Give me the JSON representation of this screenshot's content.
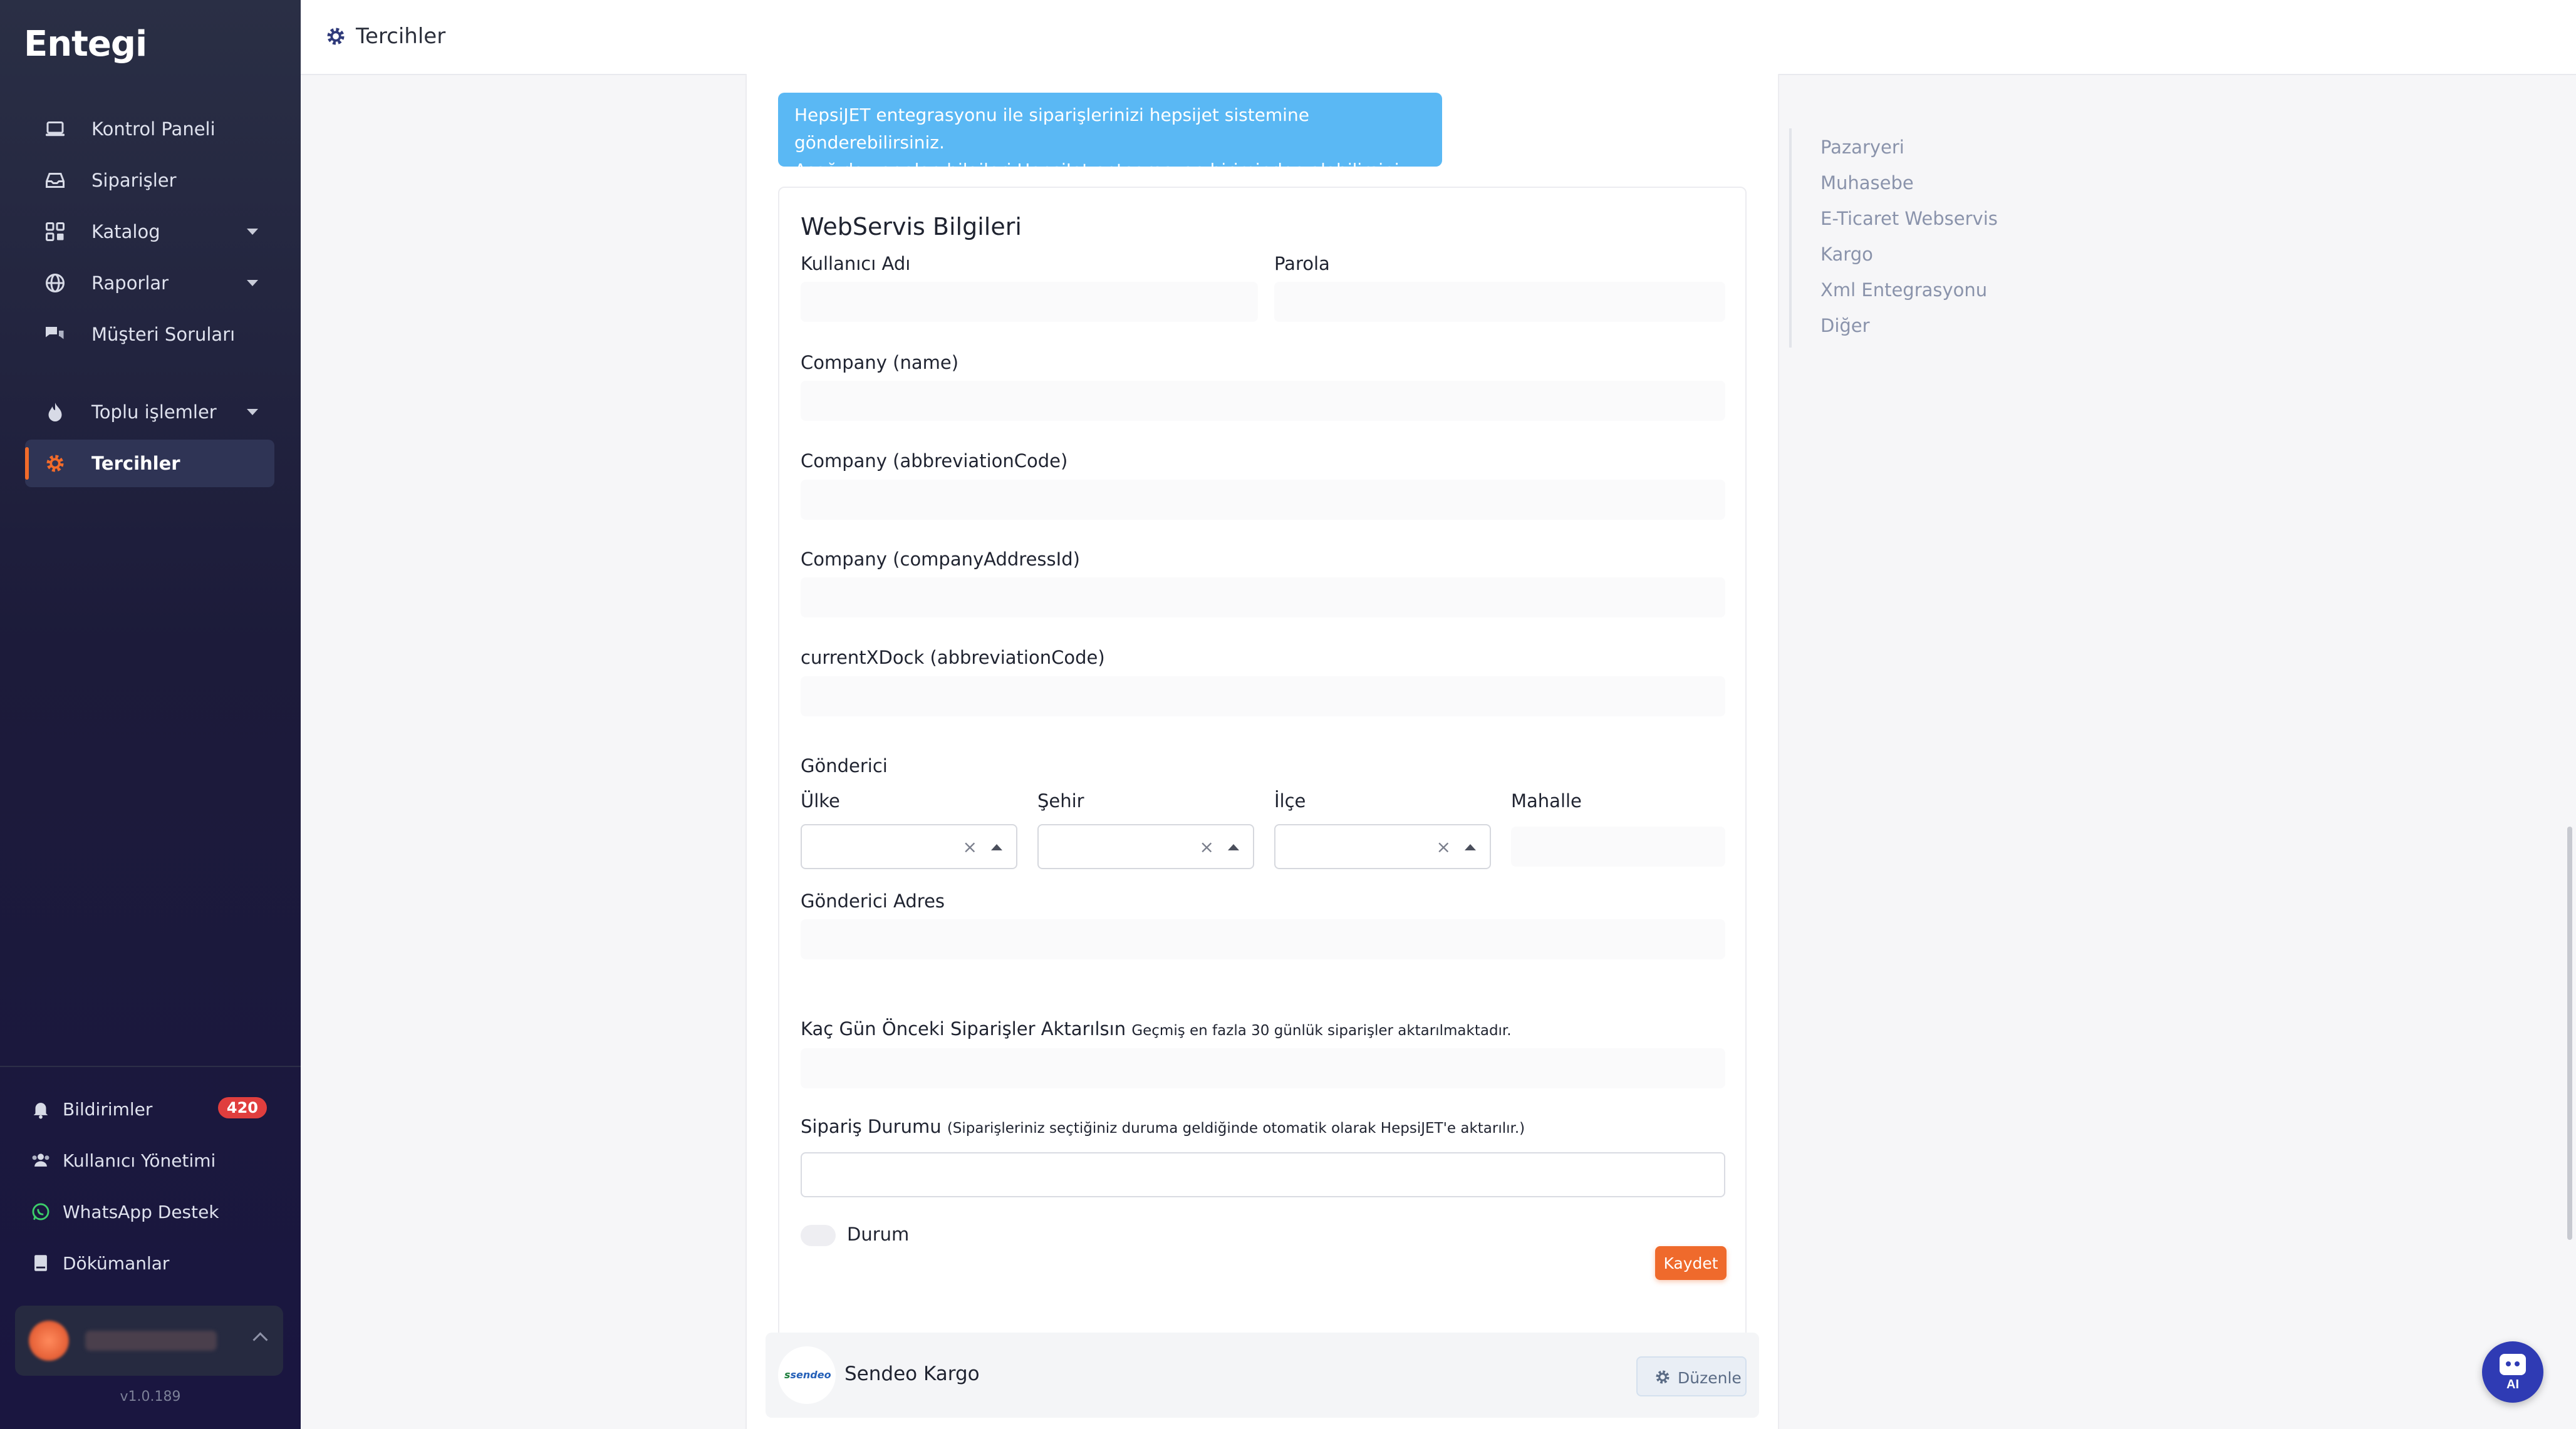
{
  "sidebar": {
    "brand": "Entegi",
    "nav": [
      {
        "label": "Kontrol Paneli",
        "icon": "laptop-icon"
      },
      {
        "label": "Siparişler",
        "icon": "inbox-icon"
      },
      {
        "label": "Katalog",
        "icon": "grid-icon",
        "has_caret": true
      },
      {
        "label": "Raporlar",
        "icon": "globe-icon",
        "has_caret": true
      },
      {
        "label": "Müşteri Soruları",
        "icon": "chat-icon"
      },
      {
        "label": "Toplu işlemler",
        "icon": "fire-icon",
        "has_caret": true
      },
      {
        "label": "Tercihler",
        "icon": "gear-icon",
        "active": true
      }
    ],
    "bottom": [
      {
        "label": "Bildirimler",
        "icon": "bell-icon",
        "badge": "420"
      },
      {
        "label": "Kullanıcı Yönetimi",
        "icon": "users-icon"
      },
      {
        "label": "WhatsApp Destek",
        "icon": "whatsapp-icon"
      },
      {
        "label": "Dökümanlar",
        "icon": "book-icon"
      }
    ],
    "version": "v1.0.189"
  },
  "header": {
    "title": "Tercihler"
  },
  "info": {
    "line1": "HepsiJET entegrasyonu ile siparişlerinizi hepsijet sistemine gönderebilirsiniz.",
    "line2": "Aşağıda yer alan bilgileri HepsiJet entegrasyon biriminden alabilirsiniz."
  },
  "form": {
    "title": "WebServis Bilgileri",
    "username_label": "Kullanıcı Adı",
    "password_label": "Parola",
    "company_name_label": "Company (name)",
    "company_abbr_label": "Company (abbreviationCode)",
    "company_address_label": "Company (companyAddressId)",
    "xdock_label": "currentXDock (abbreviationCode)",
    "sender_heading": "Gönderici",
    "country_label": "Ülke",
    "city_label": "Şehir",
    "district_label": "İlçe",
    "neighborhood_label": "Mahalle",
    "clear_symbol": "×",
    "sender_address_label": "Gönderici Adres",
    "days_label": "Kaç Gün Önceki Siparişler Aktarılsın",
    "days_hint": "Geçmiş en fazla 30 günlük siparişler aktarılmaktadır.",
    "order_status_label": "Sipariş Durumu",
    "order_status_hint": "(Siparişleriniz seçtiğiniz duruma geldiğinde otomatik olarak HepsiJET'e aktarılır.)",
    "status_toggle_label": "Durum",
    "save_label": "Kaydet"
  },
  "integration": {
    "logo_text_a": "s",
    "logo_text_b": "sendeo",
    "name": "Sendeo Kargo",
    "edit_label": "Düzenle"
  },
  "right_nav": [
    "Pazaryeri",
    "Muhasebe",
    "E-Ticaret Webservis",
    "Kargo",
    "Xml Entegrasyonu",
    "Diğer"
  ],
  "ai_button": {
    "label": "AI"
  },
  "colors": {
    "accent": "#ef6a2c",
    "info": "#5ab8f4",
    "sidebar": "#1c1b3a",
    "ai": "#2f3bb4"
  }
}
